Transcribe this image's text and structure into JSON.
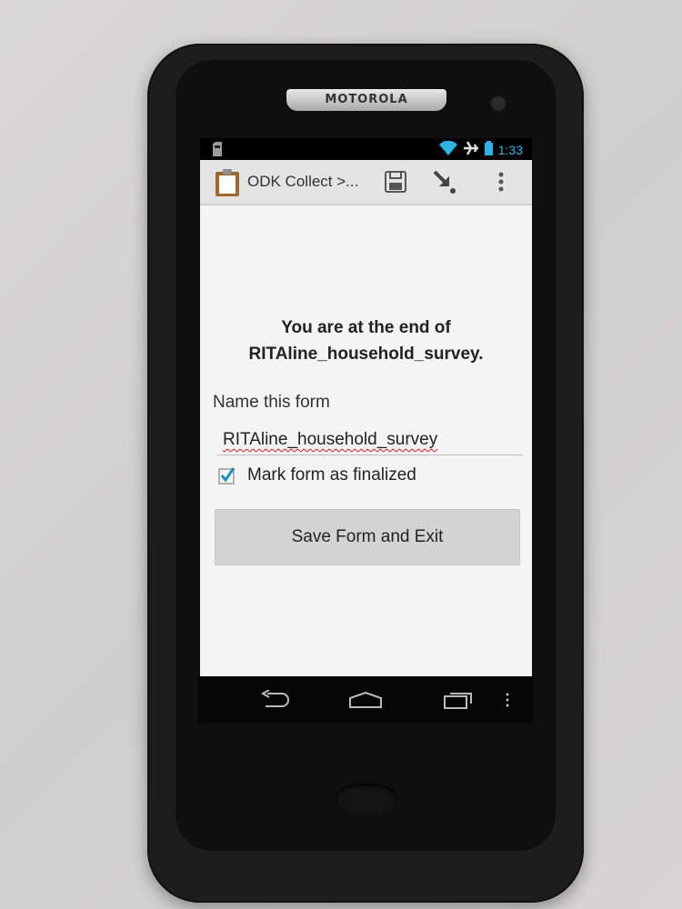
{
  "device": {
    "brand": "MOTOROLA"
  },
  "status_bar": {
    "time": "1:33",
    "icons": [
      "sd-card-icon",
      "wifi-icon",
      "airplane-icon",
      "battery-icon"
    ],
    "accent_color": "#2fb2e4"
  },
  "action_bar": {
    "title": "ODK Collect >...",
    "icons": [
      "clipboard-icon",
      "save-icon",
      "jump-icon",
      "overflow-menu-icon"
    ]
  },
  "form_end": {
    "message_line1": "You are at the end of",
    "message_line2": "RITAline_household_survey.",
    "name_label": "Name this form",
    "name_value": "RITAline_household_survey",
    "finalize_label": "Mark form as finalized",
    "finalize_checked": true,
    "save_button_label": "Save Form and Exit"
  },
  "nav_bar": {
    "icons": [
      "back-icon",
      "home-icon",
      "recent-apps-icon",
      "menu-icon"
    ]
  }
}
